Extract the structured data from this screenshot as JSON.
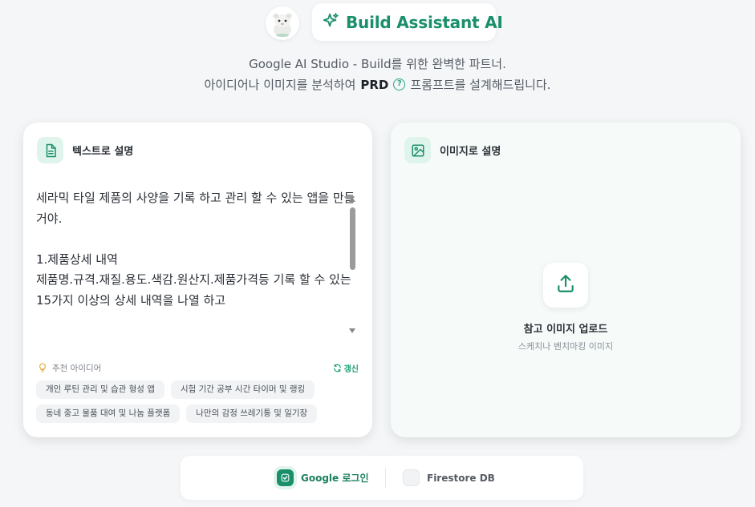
{
  "header": {
    "title": "Build Assistant AI",
    "subtitle_line1": "Google AI Studio - Build를 위한 완벽한 파트너.",
    "subtitle_line2_pre": "아이디어나 이미지를 분석하여",
    "subtitle_line2_bold": "PRD",
    "subtitle_line2_help": "?",
    "subtitle_line2_post": "프롬프트를 설계해드립니다."
  },
  "text_card": {
    "label": "텍스트로 설명",
    "text_value": "세라믹 타일 제품의 사양을 기록 하고 관리 할 수 있는 앱을 만들거야.\n\n1.제품상세 내역\n제품명.규격.재질.용도.색감.원산지.제품가격등 기록 할 수 있는 15가지 이상의 상세 내역을 나열 하고",
    "recommend_label": "추천 아이디어",
    "refresh_label": "갱신",
    "chips": [
      "개인 루틴 관리 및 습관 형성 앱",
      "시험 기간 공부 시간 타이머 및 랭킹",
      "동네 중고 물품 대여 및 나눔 플랫폼",
      "나만의 감정 쓰레기통 및 일기장"
    ]
  },
  "image_card": {
    "label": "이미지로 설명",
    "upload_title": "참고 이미지 업로드",
    "upload_subtitle": "스케치나 벤치마킹 이미지"
  },
  "toggles": {
    "google_label": "Google 로그인",
    "google_checked": true,
    "firestore_label": "Firestore DB",
    "firestore_checked": false
  },
  "colors": {
    "accent": "#1a8f6b",
    "background": "#f4f6f8"
  },
  "icons": {
    "brand": "sparkle-icon",
    "text_card": "document-icon",
    "image_card": "image-icon",
    "upload": "upload-icon",
    "recommend": "lightbulb-icon",
    "refresh": "refresh-icon",
    "check": "check-icon"
  }
}
